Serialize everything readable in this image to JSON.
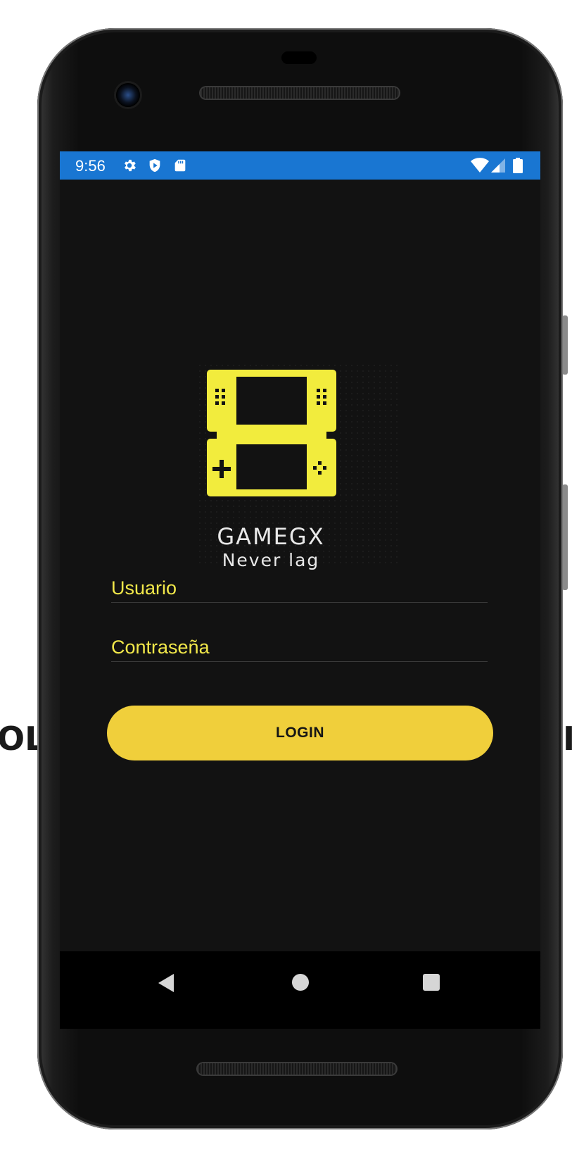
{
  "background": {
    "left_text": "OL",
    "right_text": "I"
  },
  "statusbar": {
    "time": "9:56",
    "color": "#1976d2",
    "left_icons": [
      "gear-icon",
      "shield-play-icon",
      "sd-card-icon"
    ],
    "right_icons": [
      "wifi-icon",
      "cell-signal-icon",
      "battery-icon"
    ]
  },
  "logo": {
    "brand": "GAMEGX",
    "tagline": "Never lag",
    "accent_color": "#f2ec3d"
  },
  "form": {
    "username_placeholder": "Usuario",
    "password_placeholder": "Contraseña",
    "login_label": "LOGIN",
    "button_color": "#f0cf3b",
    "text_color": "#f2e84a"
  },
  "navbar": {
    "buttons": [
      "back-icon",
      "home-icon",
      "recents-icon"
    ]
  }
}
